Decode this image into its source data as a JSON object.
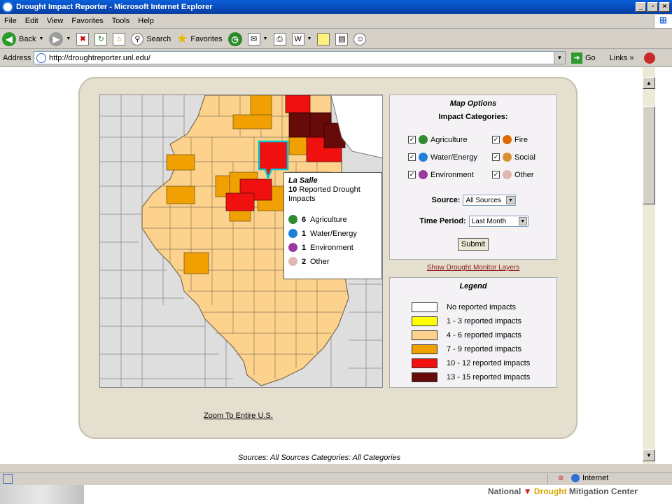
{
  "window": {
    "title": "Drought Impact Reporter - Microsoft Internet Explorer",
    "controls": [
      "_",
      "▫",
      "×"
    ]
  },
  "menu": [
    "File",
    "Edit",
    "View",
    "Favorites",
    "Tools",
    "Help"
  ],
  "toolbar": {
    "back": "Back",
    "search": "Search",
    "favorites": "Favorites"
  },
  "address": {
    "label": "Address",
    "url": "http://droughtreporter.unl.edu/",
    "go": "Go",
    "links": "Links"
  },
  "popup": {
    "county": "La Salle",
    "count": "10",
    "count_text": "Reported Drought Impacts",
    "items": [
      {
        "n": "6",
        "label": "Agriculture",
        "color": "#2e8b2e"
      },
      {
        "n": "1",
        "label": "Water/Energy",
        "color": "#1e7fd8"
      },
      {
        "n": "1",
        "label": "Environment",
        "color": "#9a3aa0"
      },
      {
        "n": "2",
        "label": "Other",
        "color": "#e0b8b0"
      }
    ]
  },
  "options": {
    "title": "Map Options",
    "categories_title": "Impact Categories:",
    "categories": [
      {
        "label": "Agriculture",
        "color": "#2e8b2e",
        "checked": "✓"
      },
      {
        "label": "Fire",
        "color": "#e06a00",
        "checked": "✓"
      },
      {
        "label": "Water/Energy",
        "color": "#1e7fd8",
        "checked": "✓"
      },
      {
        "label": "Social",
        "color": "#d89030",
        "checked": "✓"
      },
      {
        "label": "Environment",
        "color": "#9a3aa0",
        "checked": "✓"
      },
      {
        "label": "Other",
        "color": "#e0b8b0",
        "checked": "✓"
      }
    ],
    "source_label": "Source:",
    "source_value": "All Sources",
    "period_label": "Time Period:",
    "period_value": "Last Month",
    "submit": "Submit"
  },
  "show_layers": "Show Drought Monitor Layers",
  "legend": {
    "title": "Legend",
    "items": [
      {
        "label": "No reported impacts",
        "color": "#ffffff"
      },
      {
        "label": "1 - 3 reported impacts",
        "color": "#ffff00"
      },
      {
        "label": "4 - 6 reported impacts",
        "color": "#fcd28c"
      },
      {
        "label": "7 - 9 reported impacts",
        "color": "#f0a000"
      },
      {
        "label": "10 - 12 reported impacts",
        "color": "#f01010"
      },
      {
        "label": "13 - 15 reported impacts",
        "color": "#660a0a"
      }
    ]
  },
  "zoom_link": "Zoom To Entire U.S.",
  "sources_text": "Sources: All Sources  Categories: All Categories",
  "status": {
    "zone": "Internet"
  },
  "brand": {
    "left": "National",
    "mid": "Drought",
    "right": "Mitigation Center"
  }
}
